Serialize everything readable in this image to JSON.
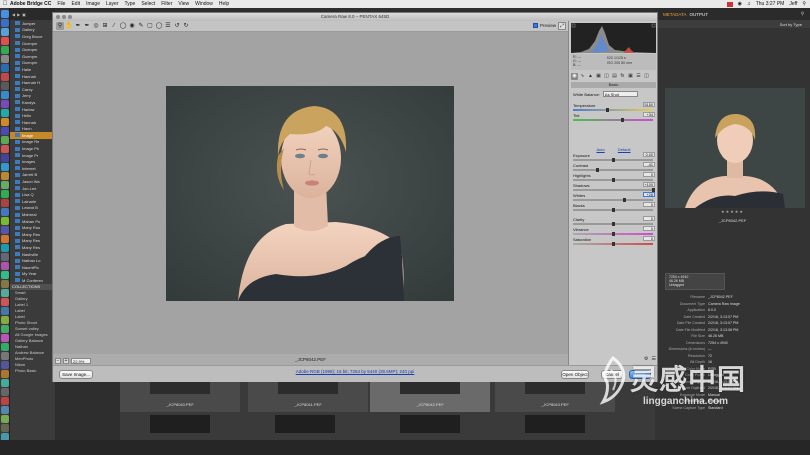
{
  "menubar": {
    "app_name": "Adobe Bridge CC",
    "menus": [
      "File",
      "Edit",
      "Image",
      "Layer",
      "Type",
      "Select",
      "Filter",
      "View",
      "Window",
      "Help"
    ],
    "clock": "Thu 3:27 PM",
    "user": "Jeff"
  },
  "bridge_left": {
    "folders": [
      "Jumper",
      "Gallery",
      "Greg Bruce",
      "Guenpm",
      "Guenpm",
      "Guenpm",
      "Guenpm",
      "Halie",
      "Hannah",
      "Hannah H",
      "Carey",
      "Jerry",
      "Kandys",
      "Harlow",
      "Hello",
      "Hannah",
      "Hann",
      "Image",
      "Image Re",
      "Image Pk",
      "Image Pr",
      "Images",
      "Internet",
      "Jarrett B",
      "Jason Wa",
      "Jon-Lee",
      "Lisa Q",
      "Lainarie",
      "Leland B",
      "Mahreal",
      "Mahan Pu",
      "Many Ros",
      "Many Res",
      "Many Res",
      "Many Res",
      "Nashville",
      "Nathan Lo",
      "NaomiPic",
      "My Year",
      "M Conferen"
    ],
    "selected_index": 17,
    "collections_header": "COLLECTIONS",
    "collections": [
      "Smart",
      "Gallery",
      "Label 1",
      "Label",
      "Label",
      "Photo Shoot",
      "Sunset valley",
      "All Google Images",
      "Gallery Balance",
      "Nathan",
      "Andrew Balance",
      "MenPhoto",
      "Nikon",
      "Photo Basic"
    ],
    "status": "34 items, 80 hidden, 1 selected · 46.36 MB"
  },
  "bridge_right": {
    "workspaces": [
      "METADATA",
      "OUTPUT"
    ],
    "sort": "Sort by Type",
    "caption": "_JCP8042.PEF",
    "stars": "★★★★★",
    "meta_box": [
      "7254 x 4940",
      "46.26 MB",
      "Untagged",
      "RGB"
    ],
    "metadata": [
      {
        "k": "Filename",
        "v": "_JCP8042.PEF"
      },
      {
        "k": "Document Type",
        "v": "Camera Raw image"
      },
      {
        "k": "Application",
        "v": "6.0.0"
      },
      {
        "k": "Date Created",
        "v": "2/2/16, 3:13:07 PM"
      },
      {
        "k": "Date File Created",
        "v": "2/2/16, 3:13:07 PM"
      },
      {
        "k": "Date File Modified",
        "v": "2/2/16, 3:13:08 PM"
      },
      {
        "k": "File Size",
        "v": "46.26 MB"
      },
      {
        "k": "Dimensions",
        "v": "7254 x 4940"
      },
      {
        "k": "Dimensions (in inches)",
        "v": "—"
      },
      {
        "k": "Resolution",
        "v": "72"
      },
      {
        "k": "Bit Depth",
        "v": "16"
      },
      {
        "k": "Color Mode",
        "v": "RGB"
      },
      {
        "k": "Color Profile",
        "v": "Untagged"
      }
    ],
    "camera_meta": [
      {
        "k": "Date Time Original",
        "v": "2/2/16, 3:13:07 PM"
      },
      {
        "k": "Date Time Digitized",
        "v": "2/2/16, 3:13:07 PM"
      },
      {
        "k": "Exposure Mode",
        "v": "Manual"
      },
      {
        "k": "White Balance",
        "v": "Manual"
      },
      {
        "k": "Scene Capture Type",
        "v": "Standard"
      }
    ]
  },
  "filmstrip": {
    "labels": [
      "_JCP8040.PEF",
      "_JCP8041.PEF",
      "_JCP8042.PEF",
      "_JCP8043.PEF"
    ]
  },
  "camera_raw": {
    "title": "Camera Raw 8.0  –  PENTAX 645D",
    "preview_label": "Preview",
    "tools": [
      "zoom-icon",
      "hand-icon",
      "white-balance-icon",
      "color-sampler-icon",
      "target-adjust-icon",
      "crop-icon",
      "straighten-icon",
      "spot-removal-icon",
      "red-eye-icon",
      "adjustment-brush-icon",
      "graduated-filter-icon",
      "radial-filter-icon",
      "preferences-icon",
      "rotate-ccw-icon",
      "rotate-cw-icon"
    ],
    "zoom_value": "22.9%",
    "filename": "_JCP8042.PEF",
    "workflow_link": "Adobe RGB (1998); 16 bit; 7264 by 5440 (39.5MP); 240 ppi",
    "buttons": {
      "save": "Save Image...",
      "open": "Open Object",
      "cancel": "Cancel",
      "done": "Done"
    },
    "readout": {
      "r": "R: ---",
      "g": "G: ---",
      "b": "B: ---",
      "aperture": "f/20  1/125 s",
      "iso": "ISO 200  80 mm"
    },
    "panel_title": "Basic",
    "white_balance_label": "White Balance:",
    "white_balance_value": "As Shot",
    "auto_label": "Auto",
    "default_label": "Default",
    "sliders": [
      {
        "label": "Temperature",
        "value": "5150",
        "pos": 0.43
      },
      {
        "label": "Tint",
        "value": "+34",
        "pos": 0.62
      },
      {
        "label": "Exposure",
        "value": "0.00",
        "pos": 0.5
      },
      {
        "label": "Contrast",
        "value": "-41",
        "pos": 0.3
      },
      {
        "label": "Highlights",
        "value": "0",
        "pos": 0.5
      },
      {
        "label": "Shadows",
        "value": "+100",
        "pos": 1.0
      },
      {
        "label": "Whites",
        "value": "+28",
        "pos": 0.64
      },
      {
        "label": "Blacks",
        "value": "0",
        "pos": 0.5
      },
      {
        "label": "Clarity",
        "value": "0",
        "pos": 0.5
      },
      {
        "label": "Vibrance",
        "value": "0",
        "pos": 0.5
      },
      {
        "label": "Saturation",
        "value": "0",
        "pos": 0.5
      }
    ]
  },
  "watermark": {
    "chinese": "灵感中国",
    "url": "lingganchina.com"
  }
}
